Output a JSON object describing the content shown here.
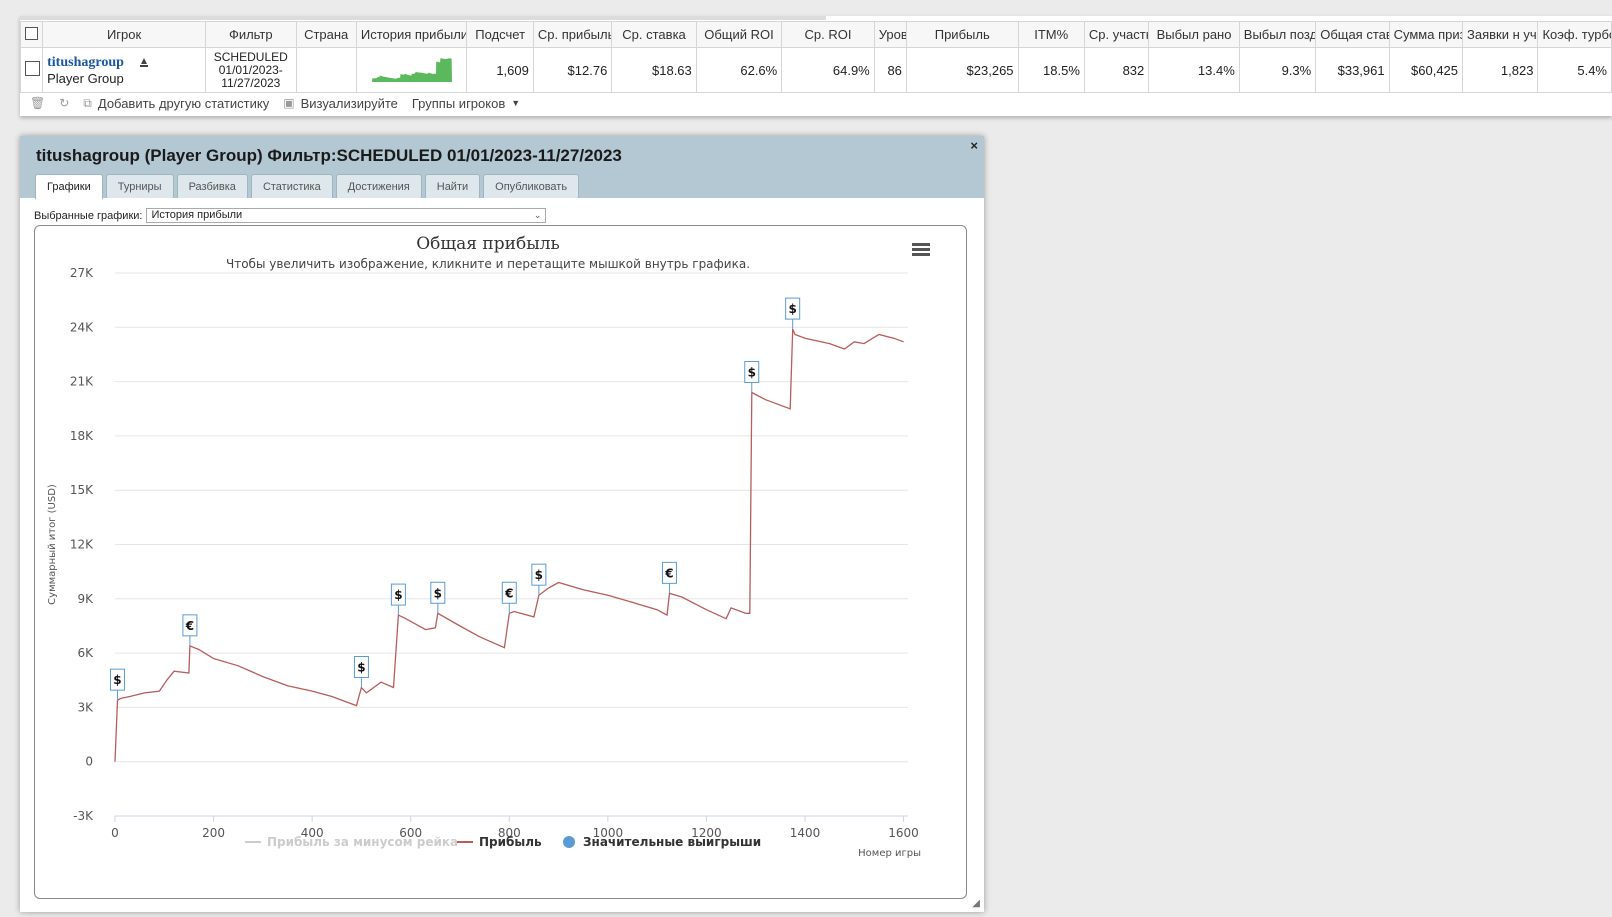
{
  "table": {
    "headers": [
      "Игрок",
      "Фильтр",
      "Страна",
      "История прибыли",
      "Подсчет",
      "Ср. прибыль",
      "Ср. ставка",
      "Общий ROI",
      "Ср. ROI",
      "Уровень",
      "Прибыль",
      "ITM%",
      "Ср. участники",
      "Выбыл рано",
      "Выбыл поздно",
      "Общая ставка",
      "Сумма призов",
      "Заявки н участие",
      "Коэф. турбо"
    ],
    "row": {
      "player_name": "titushagroup",
      "player_type": "Player Group",
      "filter": "SCHEDULED 01/01/2023-11/27/2023",
      "country": "",
      "count": "1,609",
      "avg_profit": "$12.76",
      "avg_stake": "$18.63",
      "total_roi": "62.6%",
      "avg_roi": "64.9%",
      "level": "86",
      "profit": "$23,265",
      "itm": "18.5%",
      "avg_entrants": "832",
      "early_out": "13.4%",
      "late_out": "9.3%",
      "total_stake": "$33,961",
      "prize_sum": "$60,425",
      "reentries": "1,823",
      "turbo": "5.4%"
    }
  },
  "toolbar": {
    "add_stats": "Добавить другую статистику",
    "visualize": "Визуализируйте",
    "groups": "Группы игроков"
  },
  "dialog": {
    "title": "titushagroup (Player Group) Фильтр:SCHEDULED 01/01/2023-11/27/2023",
    "close": "×",
    "tabs": [
      "Графики",
      "Турниры",
      "Разбивка",
      "Статистика",
      "Достижения",
      "Найти",
      "Опубликовать"
    ],
    "selected_charts_label": "Выбранные графики:",
    "selected_chart": "История прибыли"
  },
  "colors": {
    "profit_line": "#b85c5c",
    "marker": "#5b9bd5",
    "header_bg": "#b3c8d3",
    "link": "#1a57a4"
  },
  "chart_data": {
    "type": "line",
    "title": "Общая прибыль",
    "subtitle": "Чтобы увеличить изображение, кликните и перетащите мышкой внутрь графика.",
    "xlabel": "Номер игры",
    "ylabel": "Суммарный итог (USD)",
    "xlim": [
      0,
      1609
    ],
    "ylim": [
      -3000,
      27000
    ],
    "x_ticks": [
      0,
      200,
      400,
      600,
      800,
      1000,
      1200,
      1400,
      1600
    ],
    "y_ticks": [
      -3000,
      0,
      3000,
      6000,
      9000,
      12000,
      15000,
      18000,
      21000,
      24000,
      27000
    ],
    "y_tick_labels": [
      "-3K",
      "0",
      "3K",
      "6K",
      "9K",
      "12K",
      "15K",
      "18K",
      "21K",
      "24K",
      "27K"
    ],
    "grid": true,
    "legend": [
      "Прибыль за минусом рейка",
      "Прибыль",
      "Значительные выигрыши"
    ],
    "legend_placement": "bottom",
    "series": [
      {
        "name": "Прибыль",
        "x": [
          0,
          5,
          12,
          30,
          60,
          90,
          105,
          120,
          150,
          152,
          170,
          200,
          250,
          300,
          350,
          400,
          440,
          470,
          490,
          500,
          510,
          540,
          565,
          575,
          590,
          630,
          650,
          655,
          700,
          740,
          790,
          800,
          810,
          850,
          860,
          880,
          900,
          950,
          1000,
          1050,
          1100,
          1120,
          1125,
          1150,
          1200,
          1240,
          1250,
          1280,
          1288,
          1292,
          1320,
          1370,
          1375,
          1380,
          1400,
          1450,
          1480,
          1500,
          1520,
          1550,
          1580,
          1600
        ],
        "y": [
          0,
          3400,
          3500,
          3600,
          3800,
          3900,
          4500,
          5000,
          4900,
          6400,
          6200,
          5700,
          5300,
          4700,
          4200,
          3900,
          3600,
          3300,
          3100,
          4100,
          3800,
          4400,
          4100,
          8100,
          7900,
          7300,
          7400,
          8200,
          7500,
          6900,
          6300,
          8200,
          8300,
          8000,
          9200,
          9600,
          9900,
          9500,
          9200,
          8800,
          8400,
          8100,
          9300,
          9100,
          8400,
          7900,
          8500,
          8200,
          8200,
          20400,
          20000,
          19500,
          23900,
          23600,
          23400,
          23100,
          22800,
          23200,
          23100,
          23600,
          23400,
          23200
        ]
      }
    ],
    "big_wins": [
      {
        "x": 5,
        "y": 3400,
        "currency": "$"
      },
      {
        "x": 152,
        "y": 6400,
        "currency": "€"
      },
      {
        "x": 500,
        "y": 4100,
        "currency": "$"
      },
      {
        "x": 575,
        "y": 8100,
        "currency": "$"
      },
      {
        "x": 655,
        "y": 8200,
        "currency": "$"
      },
      {
        "x": 800,
        "y": 8200,
        "currency": "€"
      },
      {
        "x": 860,
        "y": 9200,
        "currency": "$"
      },
      {
        "x": 1125,
        "y": 9300,
        "currency": "€"
      },
      {
        "x": 1292,
        "y": 20400,
        "currency": "$"
      },
      {
        "x": 1375,
        "y": 23900,
        "currency": "$"
      }
    ]
  }
}
